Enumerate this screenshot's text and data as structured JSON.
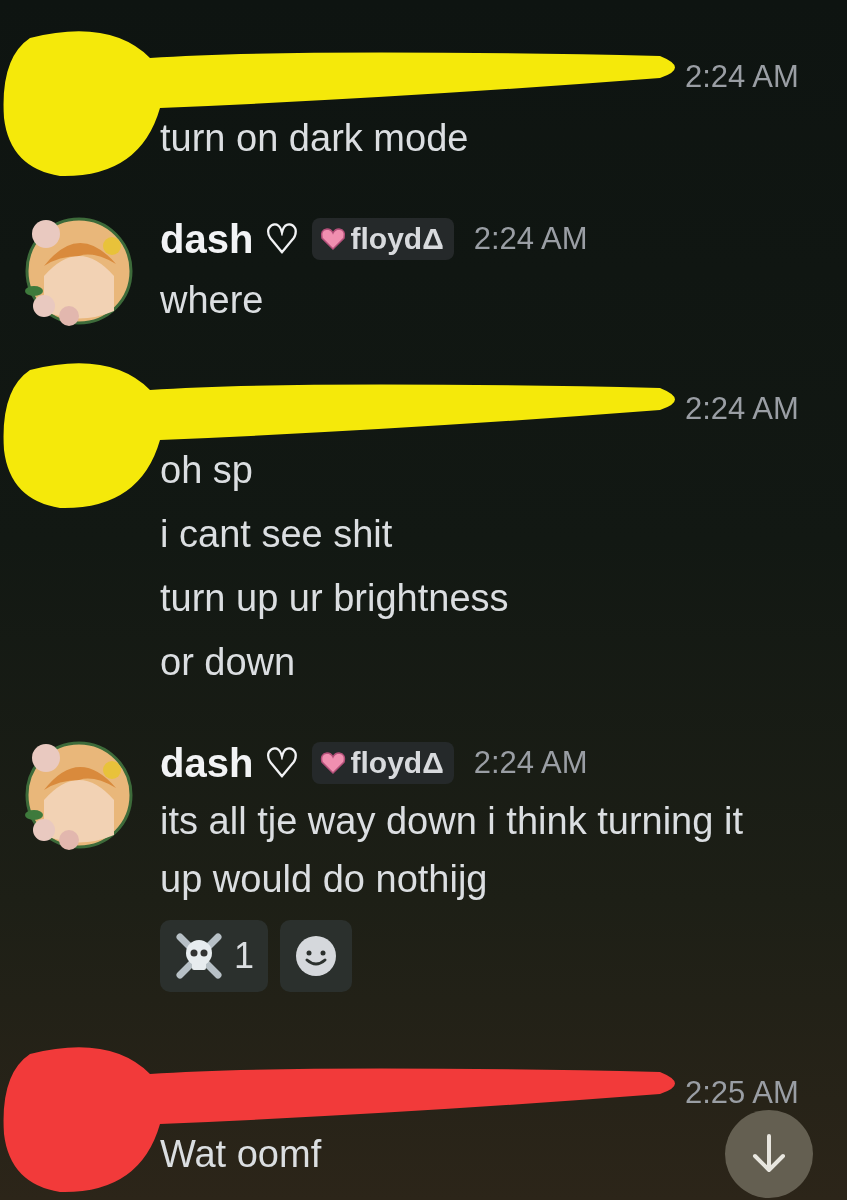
{
  "messages": [
    {
      "redacted": true,
      "color": "#f5e90a",
      "time": "2:24 AM",
      "lines": [
        "turn on dark mode"
      ]
    },
    {
      "redacted": false,
      "author": "dash ♡",
      "tag": "floydΔ",
      "time": "2:24 AM",
      "lines": [
        "where"
      ]
    },
    {
      "redacted": true,
      "color": "#f5e90a",
      "time": "2:24 AM",
      "lines": [
        "oh sp",
        "i cant see shit",
        "turn up ur brightness",
        "or down"
      ]
    },
    {
      "redacted": false,
      "author": "dash ♡",
      "tag": "floydΔ",
      "time": "2:24 AM",
      "lines": [
        "its all tje way down i think turning it up would do nothijg"
      ],
      "reactions": [
        {
          "kind": "skull",
          "count": "1"
        },
        {
          "kind": "add"
        }
      ]
    },
    {
      "redacted": true,
      "color": "#f23a3a",
      "time": "2:25 AM",
      "lines": [
        "Wat oomf"
      ]
    }
  ]
}
